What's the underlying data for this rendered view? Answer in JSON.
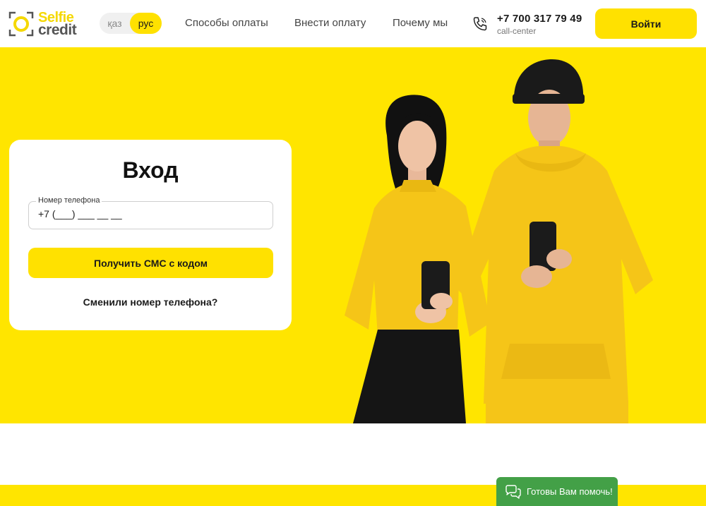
{
  "header": {
    "logo": {
      "line1": "Selfie",
      "line2": "credit"
    },
    "lang": {
      "kaz": "қаз",
      "rus": "рус"
    },
    "nav": [
      "Способы оплаты",
      "Внести оплату",
      "Почему мы"
    ],
    "phone": {
      "number": "+7 700 317 79 49",
      "caption": "call-center",
      "icon": "phone-icon"
    },
    "login_label": "Войти"
  },
  "login_card": {
    "title": "Вход",
    "phone_label": "Номер телефона",
    "phone_value": "+7 (___) ___ __ __",
    "sms_button": "Получить СМС с кодом",
    "changed_link": "Сменили номер телефона?"
  },
  "chat_widget": {
    "label": "Готовы Вам помочь!",
    "icon": "chat-bubbles-icon"
  },
  "colors": {
    "brand_yellow": "#ffe500",
    "button_yellow": "#ffe100",
    "chat_green": "#43a047"
  }
}
